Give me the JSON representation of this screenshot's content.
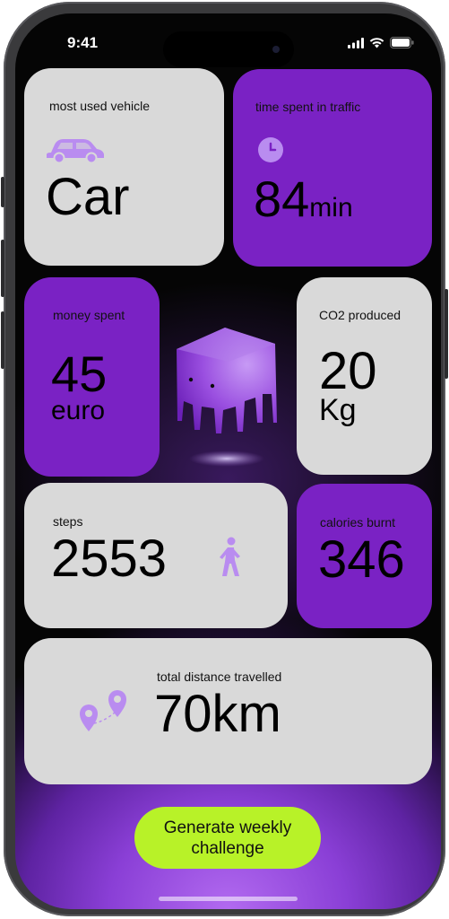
{
  "status_bar": {
    "time": "9:41"
  },
  "cards": {
    "vehicle": {
      "label": "most used vehicle",
      "value": "Car",
      "icon": "car-icon"
    },
    "traffic": {
      "label": "time spent in traffic",
      "value": "84",
      "unit": "min",
      "icon": "clock-icon"
    },
    "money": {
      "label": "money spent",
      "value": "45",
      "unit": "euro"
    },
    "co2": {
      "label": "CO2 produced",
      "value": "20",
      "unit": "Kg"
    },
    "steps": {
      "label": "steps",
      "value": "2553",
      "icon": "walking-person-icon"
    },
    "calories": {
      "label": "calories burnt",
      "value": "346"
    },
    "distance": {
      "label": "total distance travelled",
      "value": "70km",
      "icon": "route-pins-icon"
    }
  },
  "mascot": {
    "icon": "ghost-cube-mascot"
  },
  "action_button": {
    "label": "Generate weekly challenge"
  },
  "colors": {
    "accent_purple": "#7a22c4",
    "light_card": "#d9d9d9",
    "button_green": "#b8f228",
    "icon_purple": "#b98cf0"
  }
}
